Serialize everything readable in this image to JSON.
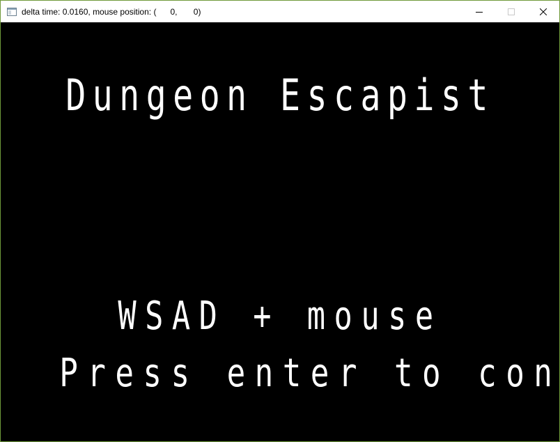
{
  "window": {
    "title": "delta time: 0.0160, mouse position: (      0,       0)",
    "app_icon": "window-app-icon",
    "minimize_icon": "minimize-icon",
    "maximize_icon": "maximize-icon",
    "close_icon": "close-icon",
    "border_color": "#6f9a3a"
  },
  "game": {
    "background_color": "#000000",
    "text_color": "#ffffff",
    "title": "Dungeon Escapist",
    "controls_hint": "WSAD + mouse",
    "continue_prompt": "Press enter to continue"
  }
}
